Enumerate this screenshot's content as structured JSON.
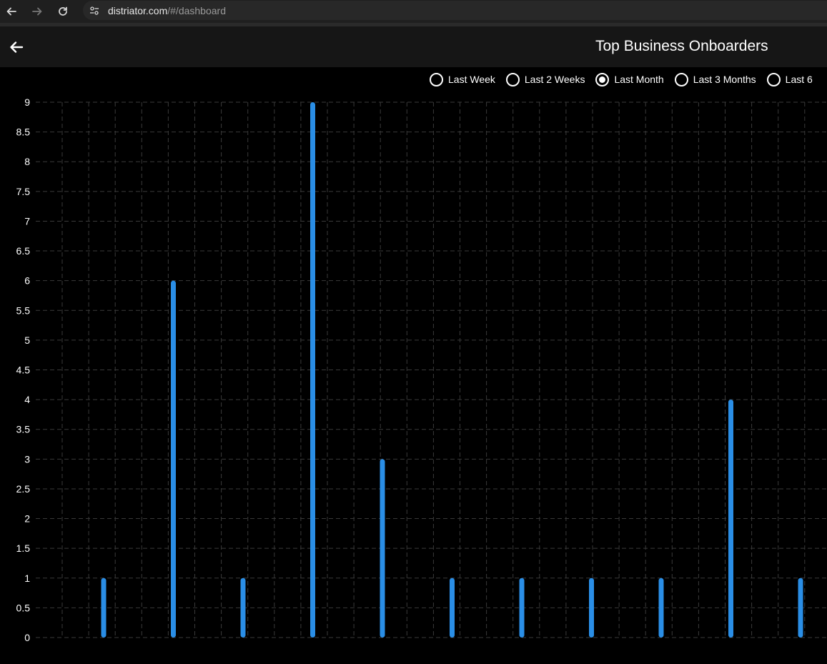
{
  "browser": {
    "url_host": "distriator.com",
    "url_path": "/#/dashboard"
  },
  "header": {
    "title": "Top Business Onboarders"
  },
  "filters": {
    "options": [
      {
        "label": "Last Week",
        "selected": false
      },
      {
        "label": "Last 2 Weeks",
        "selected": false
      },
      {
        "label": "Last Month",
        "selected": true
      },
      {
        "label": "Last 3 Months",
        "selected": false
      },
      {
        "label": "Last 6",
        "selected": false
      }
    ]
  },
  "colors": {
    "bar": "#2a8ee6",
    "grid": "#3a3a3a",
    "text": "#ffffff",
    "background": "#000000"
  },
  "chart_data": {
    "type": "bar",
    "categories": [
      "",
      "",
      "",
      "",
      "",
      "",
      "",
      "",
      "",
      "",
      ""
    ],
    "values": [
      1,
      6,
      1,
      9,
      3,
      1,
      1,
      1,
      1,
      4,
      1
    ],
    "ylim": [
      0,
      9
    ],
    "yticks": [
      "0",
      "0.5",
      "1",
      "1.5",
      "2",
      "2.5",
      "3",
      "3.5",
      "4",
      "4.5",
      "5",
      "5.5",
      "6",
      "6.5",
      "7",
      "7.5",
      "8",
      "8.5",
      "9"
    ],
    "grid": true,
    "title": "",
    "xlabel": "",
    "ylabel": ""
  }
}
